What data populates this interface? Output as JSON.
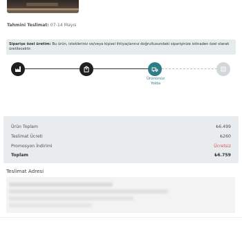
{
  "delivery": {
    "label": "Tahmini Teslimat:",
    "value": "07-14 Mayıs"
  },
  "notice": {
    "title": "Siparişe özel üretim:",
    "text": "Bu ürün, istekleriniz ve/veya kişisel ihtiyaçlarınız doğrultusundaki siparişinize istinaden özel olarak üretilecektir."
  },
  "stepper": {
    "steps": [
      {
        "icon": "factory-icon",
        "state": "done"
      },
      {
        "icon": "package-icon",
        "state": "done"
      },
      {
        "icon": "truck-icon",
        "state": "active",
        "label_line1": "Ürününüz",
        "label_line2": "Yolda"
      },
      {
        "icon": "home-icon",
        "state": "pending"
      }
    ]
  },
  "summary": {
    "rows": [
      {
        "label": "Ürün Toplam",
        "value": "₺6.499"
      },
      {
        "label": "Teslimat Ücreti",
        "value": "₺260"
      },
      {
        "label": "Promosyon İndirimi",
        "value": "Ücretsiz"
      },
      {
        "label": "Toplam",
        "value": "₺6.759"
      }
    ]
  },
  "address": {
    "title": "Teslimat Adresi"
  },
  "colors": {
    "accent": "#2f7d85",
    "free_text": "#d9534f",
    "done_step": "#1f1f1f",
    "pending_step": "#d2d8da"
  }
}
